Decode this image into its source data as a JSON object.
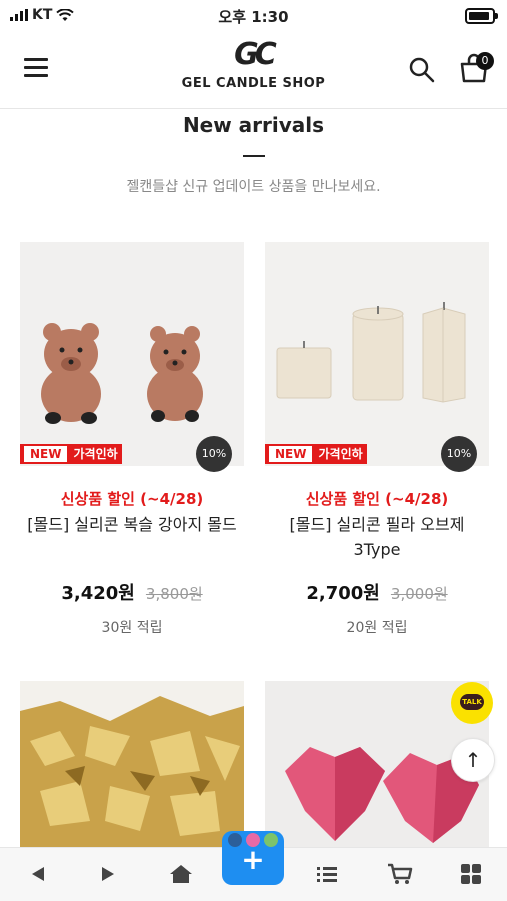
{
  "status": {
    "carrier": "KT",
    "time": "오후 1:30"
  },
  "header": {
    "logo_mark": "GC",
    "shop_name": "GEL CANDLE SHOP",
    "cart_count": "0"
  },
  "section": {
    "title": "New arrivals",
    "subtitle": "젤캔들샵 신규 업데이트 상품을 만나보세요."
  },
  "products": [
    {
      "tag_new": "NEW",
      "tag_sale": "가격인하",
      "discount": "10%",
      "promo": "신상품 할인 (~4/28)",
      "name": "[몰드] 실리콘 복슬 강아지 몰드",
      "price": "3,420원",
      "original_price": "3,800원",
      "points": "30원 적립"
    },
    {
      "tag_new": "NEW",
      "tag_sale": "가격인하",
      "discount": "10%",
      "promo": "신상품 할인 (~4/28)",
      "name": "[몰드] 실리콘 필라 오브제 3Type",
      "price": "2,700원",
      "original_price": "3,000원",
      "points": "20원 적립"
    }
  ],
  "floating": {
    "talk_label": "TALK",
    "top_arrow": "↑"
  },
  "bottom_nav": {
    "add_label": "+"
  },
  "colors": {
    "accent_red": "#e21b1b",
    "fab_blue": "#1e8ef1",
    "talk_yellow": "#fae100"
  }
}
